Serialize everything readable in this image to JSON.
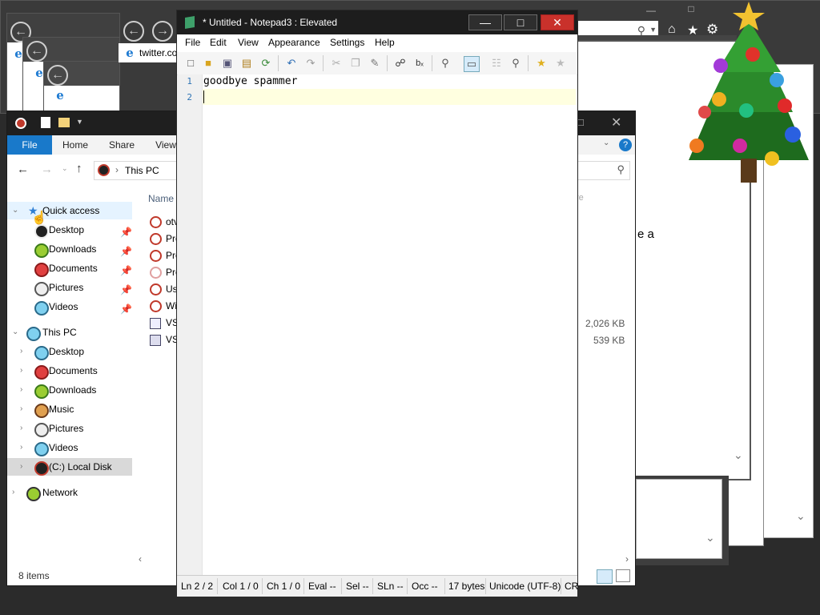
{
  "browser": {
    "tab_label": "twitter.com"
  },
  "behind_text": "e a",
  "explorer": {
    "ribbon_tabs": [
      "File",
      "Home",
      "Share",
      "View"
    ],
    "breadcrumb": "This PC",
    "column_name": "Name",
    "column_size": "re",
    "quick_access": "Quick access",
    "quick_items": [
      "Desktop",
      "Downloads",
      "Documents",
      "Pictures",
      "Videos"
    ],
    "this_pc": "This PC",
    "pc_items": [
      "Desktop",
      "Documents",
      "Downloads",
      "Music",
      "Pictures",
      "Videos",
      "(C:) Local Disk"
    ],
    "network": "Network",
    "files": [
      "otv",
      "Pro",
      "Pro",
      "Pro",
      "Us",
      "Wi",
      "VS",
      "VS"
    ],
    "sizes": [
      "2,026 KB",
      "539 KB"
    ],
    "status": "8 items",
    "colors": {
      "file_tab": "#1979ca",
      "selected": "#d9d9d9"
    }
  },
  "notepad": {
    "title": "* Untitled - Notepad3 : Elevated",
    "menu": [
      "File",
      "Edit",
      "View",
      "Appearance",
      "Settings",
      "Help"
    ],
    "lines": [
      "goodbye spammer",
      ""
    ],
    "line_numbers": [
      "1",
      "2"
    ],
    "status": {
      "ln": "Ln  2 / 2",
      "col": "Col  1 / 0",
      "ch": "Ch  1 / 0",
      "eval": "Eval  --",
      "sel": "Sel  --",
      "sln": "SLn  --",
      "occ": "Occ  --",
      "bytes": "17 bytes",
      "encoding": "Unicode (UTF-8)",
      "eol": "CR"
    },
    "colors": {
      "title_bg": "#1d1d1d",
      "current_line": "#ffffe0",
      "close": "#c9312b"
    }
  }
}
